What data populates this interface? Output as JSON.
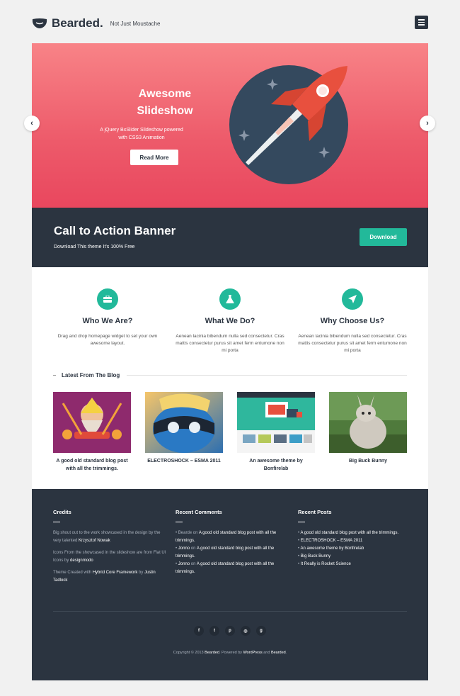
{
  "header": {
    "brand": "Bearded.",
    "tagline": "Not Just Moustache",
    "logo_icon": "beard-icon",
    "menu_icon": "hamburger-icon"
  },
  "slider": {
    "title_line1": "Awesome",
    "title_line2": "Slideshow",
    "subtitle_line1": "A jQuery BxSlider Slideshow powered",
    "subtitle_line2": "with CSS3 Animation",
    "button": "Read More",
    "prev_icon": "chevron-left-icon",
    "next_icon": "chevron-right-icon",
    "illustration": "rocket-icon"
  },
  "cta": {
    "title": "Call to Action Banner",
    "subtitle": "Download This theme It's 100% Free",
    "button": "Download"
  },
  "features": [
    {
      "icon": "briefcase-icon",
      "title": "Who We Are?",
      "text": "Drag and drop homepage widget to set your own awesome layout."
    },
    {
      "icon": "flask-icon",
      "title": "What We Do?",
      "text": "Aenean lacinia bibendum nulla sed consectetur. Cras mattis consectetur purus sit amet ferm entumone non mi porta"
    },
    {
      "icon": "rocket-icon",
      "title": "Why Choose Us?",
      "text": "Aenean lacinia bibendum nulla sed consectetur. Cras mattis consectetur purus sit amet ferm entumone non mi porta"
    }
  ],
  "blog": {
    "heading": "Latest From The Blog",
    "posts": [
      {
        "title": "A good old standard blog post with all the trimmings."
      },
      {
        "title": "ELECTROSHOCK – ESMA 2011"
      },
      {
        "title": "An awesome theme by Bonfirelab"
      },
      {
        "title": "Big Buck Bunny"
      }
    ]
  },
  "footer": {
    "credits": {
      "title": "Credits",
      "p1_a": "Big shout out to the work showcased in the design by the very talented ",
      "p1_b": "Krzysztof Nowak",
      "p2_a": "Icons From the showcased in the slideshow are from Flat UI Icons by ",
      "p2_b": "designmodo",
      "p3_a": "Theme Created with ",
      "p3_b": "Hybrid Core Framework",
      "p3_c": " by ",
      "p3_d": "Justin Tadlock"
    },
    "comments": {
      "title": "Recent Comments",
      "items": [
        {
          "author": "Bearde",
          "on": " on ",
          "post": "A good old standard blog post with all the trimmings."
        },
        {
          "author": "Jonno",
          "on": " on ",
          "post": "A good old standard blog post with all the trimmings."
        },
        {
          "author": "Jonno",
          "on": " on ",
          "post": "A good old standard blog post with all the trimmings."
        }
      ]
    },
    "posts": {
      "title": "Recent Posts",
      "items": [
        "A good old standard blog post with all the trimmings.",
        "ELECTROSHOCK – ESMA 2011",
        "An awesome theme by Bonfirelab",
        "Big Buck Bunny",
        "It Really is Rocket Science"
      ]
    },
    "social": [
      {
        "icon": "facebook-icon",
        "glyph": "f"
      },
      {
        "icon": "twitter-icon",
        "glyph": "t"
      },
      {
        "icon": "pinterest-icon",
        "glyph": "p"
      },
      {
        "icon": "dribbble-icon",
        "glyph": "◎"
      },
      {
        "icon": "github-icon",
        "glyph": "g"
      }
    ],
    "copyright_a": "Copyright © 2013 ",
    "copyright_b": "Bearded",
    "copyright_c": ". Powered by ",
    "copyright_d": "WordPress",
    "copyright_e": " and ",
    "copyright_f": "Bearded",
    "copyright_g": "."
  },
  "colors": {
    "dark": "#2b3440",
    "accent": "#22b99a",
    "slider_top": "#f88387",
    "slider_bottom": "#e9475e",
    "rocket": "#e8503e"
  }
}
